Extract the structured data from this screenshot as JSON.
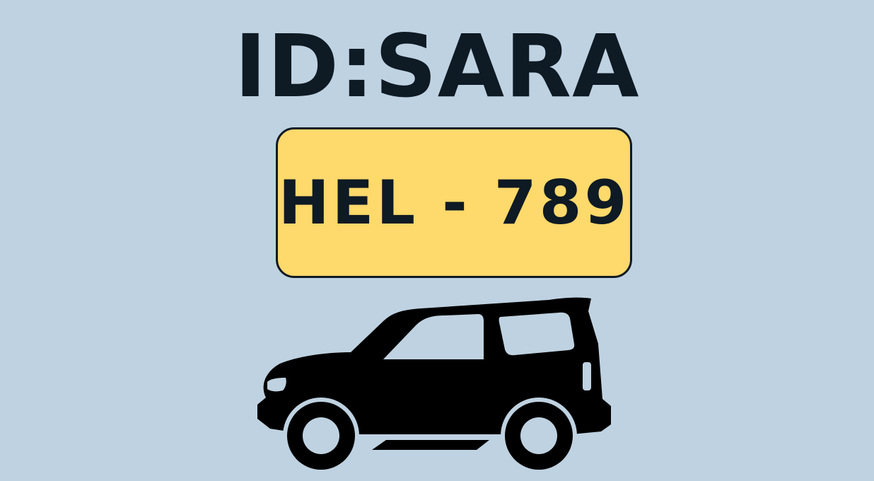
{
  "colors": {
    "background": "#bfd2e1",
    "text": "#0e1a24",
    "plate_fill": "#fed96b",
    "plate_border": "#0e1a24",
    "car": "#000000",
    "car_cutout": "#bfd2e1"
  },
  "header": {
    "title": "ID:SARA"
  },
  "plate": {
    "number": "HEL - 789"
  },
  "illustration": {
    "icon": "suv-car-icon"
  }
}
